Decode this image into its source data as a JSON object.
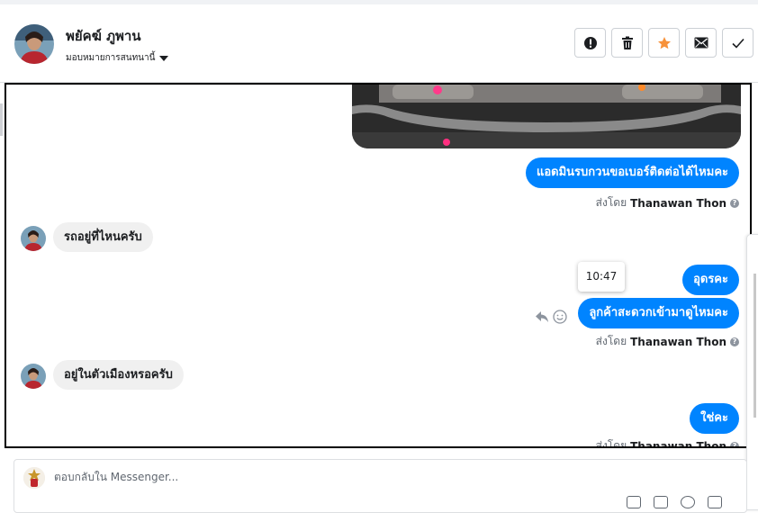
{
  "header": {
    "contact_name": "พยัคฆ์ ภูพาน",
    "assign_label": "มอบหมายการสนทนานี้",
    "actions": [
      "spam-icon",
      "trash-icon",
      "star-icon",
      "mail-icon",
      "check-icon"
    ],
    "star_color": "#f7923a"
  },
  "messages": [
    {
      "side": "out",
      "text": "แอดมินรบกวนขอเบอร์ติดต่อได้ไหมคะ"
    },
    {
      "side": "in",
      "text": "รถอยู่ที่ไหนครับ"
    },
    {
      "side": "out",
      "text": "อุดรคะ"
    },
    {
      "side": "out",
      "text": "ลูกค้าสะดวกเข้ามาดูไหมคะ"
    },
    {
      "side": "in",
      "text": "อยู่ในตัวเมืองหรอครับ"
    },
    {
      "side": "out",
      "text": "ใช่คะ"
    }
  ],
  "sent_by": {
    "prefix": "ส่งโดย",
    "name": "Thanawan Thon"
  },
  "tooltip_time": "10:47",
  "composer": {
    "placeholder": "ตอบกลับใน Messenger..."
  },
  "colors": {
    "outgoing": "#0084ff",
    "incoming": "#f0f0f0"
  }
}
